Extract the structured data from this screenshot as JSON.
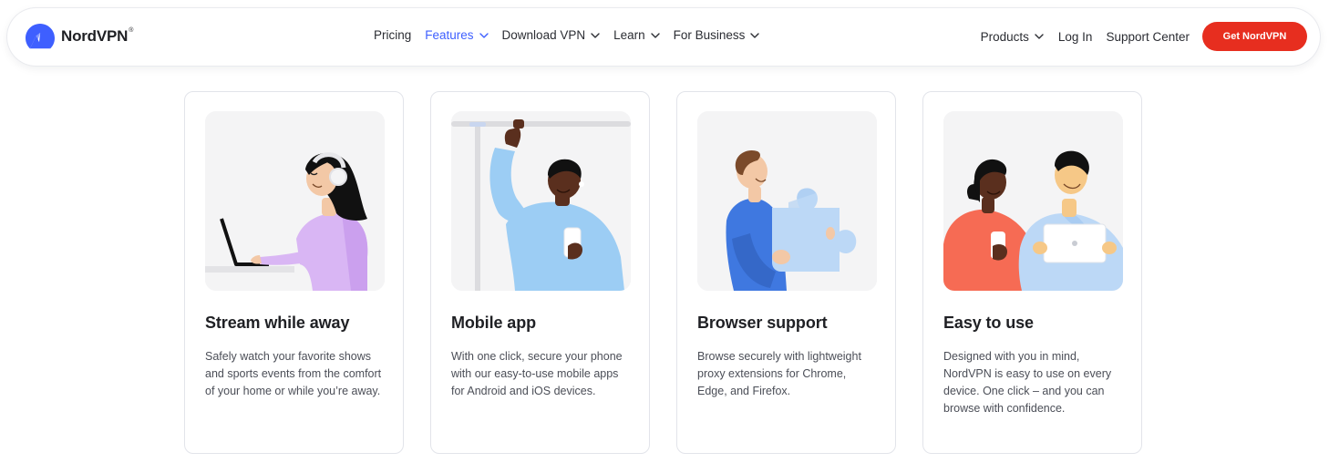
{
  "header": {
    "brand": {
      "name": "NordVPN",
      "registered_mark": "®",
      "logo_icon": "nord-mountain-logo-icon"
    },
    "nav": [
      {
        "label": "Pricing",
        "has_dropdown": false,
        "active": false
      },
      {
        "label": "Features",
        "has_dropdown": true,
        "active": true
      },
      {
        "label": "Download VPN",
        "has_dropdown": true,
        "active": false
      },
      {
        "label": "Learn",
        "has_dropdown": true,
        "active": false
      },
      {
        "label": "For Business",
        "has_dropdown": true,
        "active": false
      }
    ],
    "right": {
      "products": "Products",
      "login": "Log In",
      "support": "Support Center",
      "cta": "Get NordVPN"
    }
  },
  "features": [
    {
      "title": "Stream while away",
      "text": "Safely watch your favorite shows and sports events from the comfort of your home or while you’re away.",
      "illustration": "woman-with-headphones-laptop-illustration"
    },
    {
      "title": "Mobile app",
      "text": "With one click, secure your phone with our easy-to-use mobile apps for Android and iOS devices.",
      "illustration": "commuter-holding-phone-illustration"
    },
    {
      "title": "Browser support",
      "text": "Browse securely with lightweight proxy extensions for Chrome, Edge, and Firefox.",
      "illustration": "man-holding-puzzle-piece-illustration"
    },
    {
      "title": "Easy to use",
      "text": "Designed with you in mind, NordVPN is easy to use on every device. One click – and you can browse with confidence.",
      "illustration": "two-people-with-devices-illustration"
    }
  ],
  "colors": {
    "accent_active_nav": "#3e5fff",
    "cta_red": "#e72e1f",
    "logo_blue": "#3e5fff",
    "card_border": "#e2e4ea"
  }
}
